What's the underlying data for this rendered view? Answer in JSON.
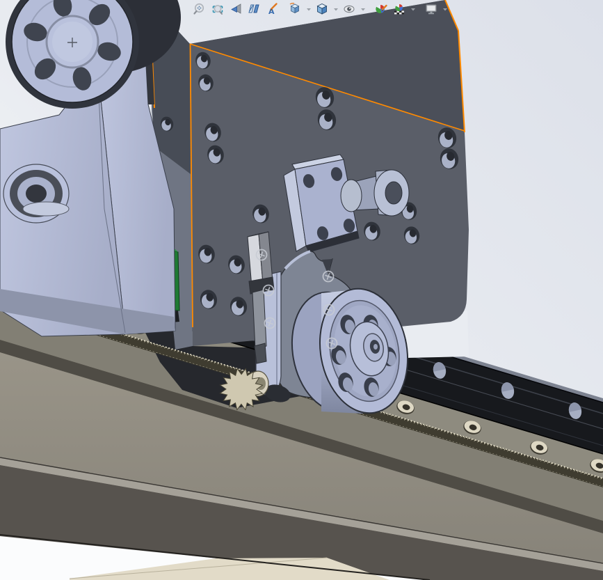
{
  "app": {
    "kind": "cad-3d-viewport",
    "visible_text": "none"
  },
  "toolbar": {
    "name": "heads-up-view-toolbar",
    "items": [
      {
        "id": "zoom-to-fit",
        "icon": "magnifier-fit-icon",
        "has_dropdown": false
      },
      {
        "id": "zoom-to-area",
        "icon": "magnifier-area-icon",
        "has_dropdown": false
      },
      {
        "id": "previous-view",
        "icon": "back-arrow-camera-icon",
        "has_dropdown": false
      },
      {
        "id": "section-view",
        "icon": "section-planes-icon",
        "has_dropdown": false
      },
      {
        "id": "annotation-views",
        "icon": "pencil-letter-a-icon",
        "has_dropdown": false
      },
      {
        "id": "view-orientation",
        "icon": "view-cube-icon",
        "has_dropdown": true
      },
      {
        "id": "display-style",
        "icon": "shaded-cube-icon",
        "has_dropdown": true
      },
      {
        "id": "hide-show-items",
        "icon": "eye-icon",
        "has_dropdown": true
      },
      {
        "id": "edit-appearance",
        "icon": "color-ball-pencil-icon",
        "has_dropdown": false
      },
      {
        "id": "apply-scene",
        "icon": "color-ball-scene-icon",
        "has_dropdown": true
      },
      {
        "id": "view-settings",
        "icon": "monitor-icon",
        "has_dropdown": true
      }
    ]
  },
  "scene": {
    "selected_part": "gantry-mounting-plate",
    "selection_edge_color": "#ff8a00",
    "parts": [
      {
        "name": "gantry-mounting-plate",
        "color": "#5a5e68"
      },
      {
        "name": "motor-flange-housing",
        "color": "#b4bcd8"
      },
      {
        "name": "linear-rail",
        "color": "#17191d"
      },
      {
        "name": "rail-carriage-block",
        "colors": [
          "#d81812",
          "#1f7a33"
        ]
      },
      {
        "name": "gear-rack",
        "color": "#ddd6c0"
      },
      {
        "name": "pinion-gear",
        "color": "#cfc8b0"
      },
      {
        "name": "idler-pulley",
        "color": "#b3bbd7"
      },
      {
        "name": "bearing-block-shaft",
        "color": "#aab2cf"
      },
      {
        "name": "pinion-bracket",
        "color": "#7e8594"
      },
      {
        "name": "sensor-bracket",
        "color": "#d2d5dc"
      },
      {
        "name": "beam-extrusion",
        "color": "#8e8a80"
      }
    ],
    "background": {
      "top_right": "#dce0e9",
      "bottom_left": "#fdfdfe"
    }
  }
}
